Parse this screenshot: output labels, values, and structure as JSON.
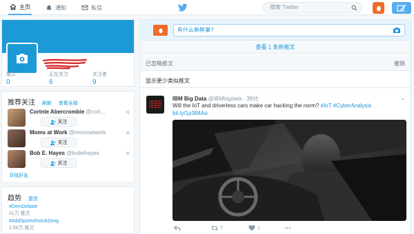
{
  "nav": {
    "home": "主页",
    "notifications": "通知",
    "messages": "私信",
    "search_placeholder": "搜索 Twitter"
  },
  "profile": {
    "stats": [
      {
        "label": "推文",
        "value": "0"
      },
      {
        "label": "正在关注",
        "value": "6"
      },
      {
        "label": "关注者",
        "value": "9"
      }
    ]
  },
  "suggestions": {
    "title": "推荐关注",
    "separator": "·",
    "refresh": "刷新",
    "view_all": "查看全部",
    "follow_label": "关注",
    "find_friends": "寻找好友",
    "items": [
      {
        "name": "Cortnie Abercrombie",
        "handle": "@cort..."
      },
      {
        "name": "Moms at Work",
        "handle": "@momsatwork"
      },
      {
        "name": "Bob E. Hayes",
        "handle": "@bobehayes"
      }
    ]
  },
  "trends": {
    "title": "趋势",
    "separator": "·",
    "change": "更改",
    "items": [
      {
        "tag": "#DemDebate",
        "count": "81万 推文"
      },
      {
        "tag": "#AddSportsRuinASong",
        "count": "2.56万 推文"
      }
    ]
  },
  "composer": {
    "placeholder": "有什么新鲜事?"
  },
  "timeline": {
    "new_tweets": "查看 1 条新推文",
    "muted_label": "已忽略推文",
    "undo": "撤销",
    "show_less": "显示更少类似推文"
  },
  "tweet": {
    "name": "IBM Big Data",
    "handle": "@IBMbigdata",
    "time": "38分",
    "text": "Will the IoT and driverless cars make car hacking the norm?",
    "hashtags": "#IoT #CyberAnalysis",
    "link": "bit.ly/1p384Ao",
    "retweets": "7",
    "likes": "1"
  },
  "colors": {
    "accent": "#55acee",
    "link": "#1b95e0",
    "avatar_orange": "#ef6c2a",
    "banner": "#1c9ad6"
  }
}
